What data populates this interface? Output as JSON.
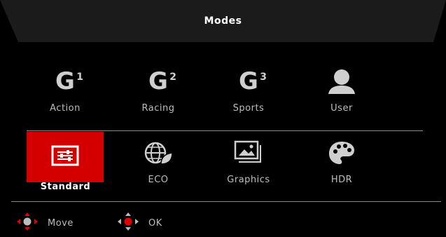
{
  "osd": {
    "title": "Modes",
    "modes_row1": [
      {
        "label": "Action",
        "icon": "g1-icon",
        "glyph": "G",
        "sup": "1"
      },
      {
        "label": "Racing",
        "icon": "g2-icon",
        "glyph": "G",
        "sup": "2"
      },
      {
        "label": "Sports",
        "icon": "g3-icon",
        "glyph": "G",
        "sup": "3"
      },
      {
        "label": "User",
        "icon": "user-icon"
      }
    ],
    "modes_row2": [
      {
        "label": "Standard",
        "icon": "sliders-icon",
        "selected": true
      },
      {
        "label": "ECO",
        "icon": "eco-globe-icon"
      },
      {
        "label": "Graphics",
        "icon": "picture-icon"
      },
      {
        "label": "HDR",
        "icon": "palette-icon"
      }
    ],
    "footer": {
      "move_label": "Move",
      "ok_label": "OK"
    },
    "colors": {
      "accent": "#d40000",
      "background": "#000000",
      "text": "#bdbdbd"
    }
  }
}
